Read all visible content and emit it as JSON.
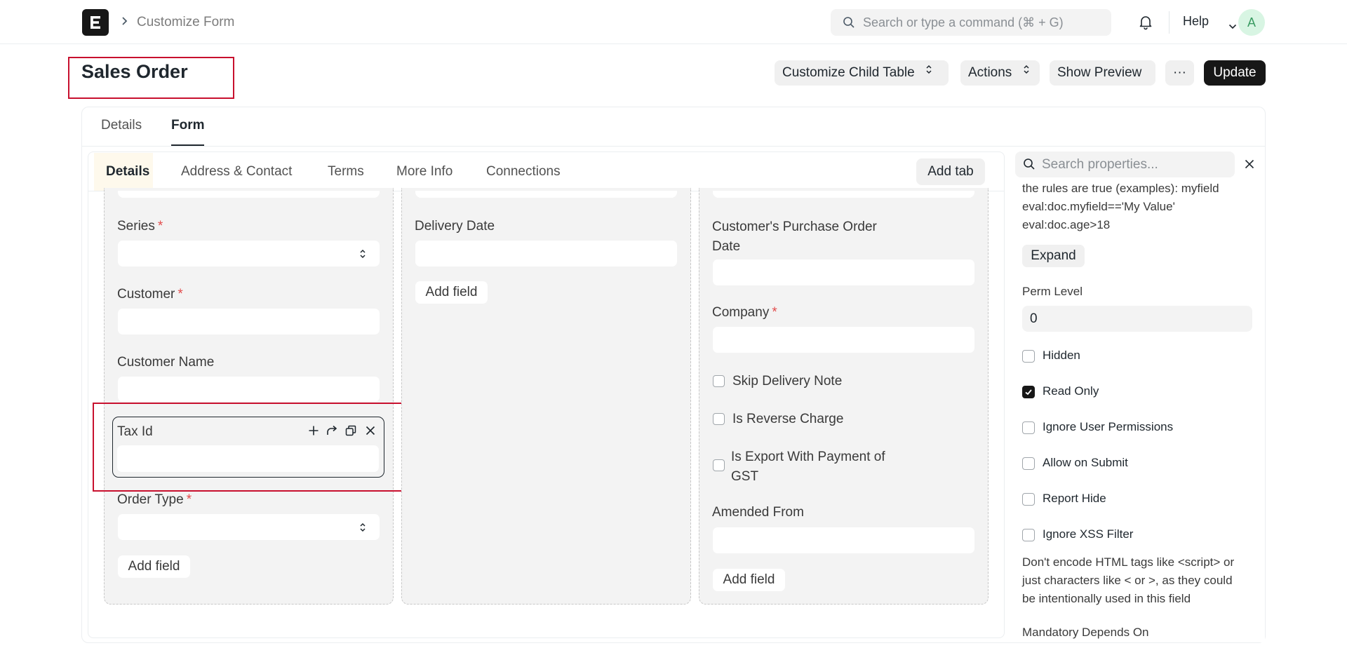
{
  "navbar": {
    "breadcrumb": "Customize Form",
    "search_placeholder": "Search or type a command (⌘ + G)",
    "help_label": "Help",
    "avatar_initial": "A",
    "icons": [
      "app-logo-icon",
      "chevron-right-icon",
      "search-icon",
      "bell-icon",
      "chevron-down-icon"
    ]
  },
  "page": {
    "title": "Sales Order",
    "buttons": {
      "customize_child_table": "Customize Child Table",
      "actions": "Actions",
      "show_preview": "Show Preview",
      "more": "···",
      "update": "Update"
    }
  },
  "top_tabs": [
    {
      "label": "Details",
      "active": false
    },
    {
      "label": "Form",
      "active": true
    }
  ],
  "form_tabs": {
    "items": [
      {
        "label": "Details",
        "active": true
      },
      {
        "label": "Address & Contact",
        "active": false
      },
      {
        "label": "Terms",
        "active": false
      },
      {
        "label": "More Info",
        "active": false
      },
      {
        "label": "Connections",
        "active": false
      }
    ],
    "add_tab_label": "Add tab"
  },
  "columns": {
    "col1": {
      "fields": [
        {
          "label": "Series",
          "required": "*",
          "type": "select"
        },
        {
          "label": "Customer",
          "required": "*",
          "type": "input"
        },
        {
          "label": "Customer Name",
          "type": "input"
        },
        {
          "label": "Tax Id",
          "type": "input",
          "selected": true
        },
        {
          "label": "Order Type",
          "required": "*",
          "type": "select"
        }
      ],
      "add_field_label": "Add field"
    },
    "col2": {
      "fields": [
        {
          "label": "Delivery Date",
          "type": "input"
        }
      ],
      "add_field_label": "Add field"
    },
    "col3": {
      "fields": [
        {
          "label": "Customer's Purchase Order Date",
          "type": "input"
        },
        {
          "label": "Company",
          "required": "*",
          "type": "input"
        },
        {
          "label": "Skip Delivery Note",
          "type": "check"
        },
        {
          "label": "Is Reverse Charge",
          "type": "check"
        },
        {
          "label": "Is Export With Payment of GST",
          "type": "check"
        },
        {
          "label": "Amended From",
          "type": "input"
        }
      ],
      "add_field_label": "Add field"
    }
  },
  "properties": {
    "search_placeholder": "Search properties...",
    "depends_on_help": "the rules are true (examples): myfield eval:doc.myfield=='My Value' eval:doc.age>18",
    "expand_label": "Expand",
    "perm_level_label": "Perm Level",
    "perm_level_value": "0",
    "checkboxes": [
      {
        "label": "Hidden",
        "checked": false
      },
      {
        "label": "Read Only",
        "checked": true
      },
      {
        "label": "Ignore User Permissions",
        "checked": false
      },
      {
        "label": "Allow on Submit",
        "checked": false
      },
      {
        "label": "Report Hide",
        "checked": false
      },
      {
        "label": "Ignore XSS Filter",
        "checked": false
      }
    ],
    "xss_help": "Don't encode HTML tags like <script> or just characters like < or >, as they could be intentionally used in this field",
    "mandatory_depends_on_label": "Mandatory Depends On"
  }
}
